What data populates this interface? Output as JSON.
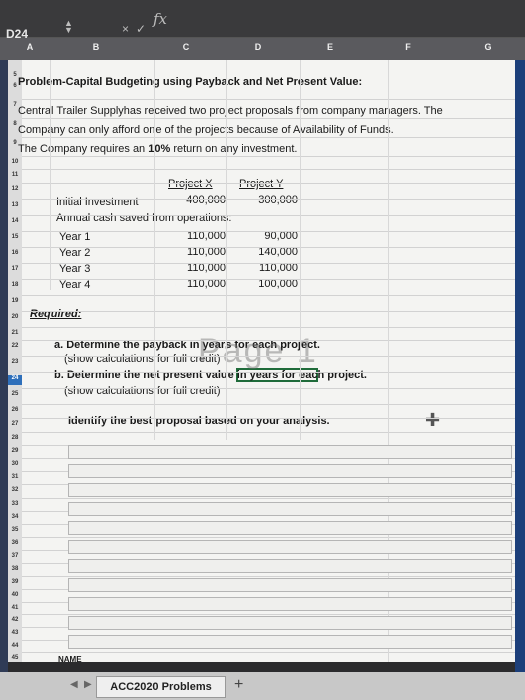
{
  "formula_bar": {
    "name_box": "D24",
    "fx_label": "fx",
    "cancel": "×",
    "confirm": "✓",
    "value": ""
  },
  "columns": [
    "A",
    "B",
    "C",
    "D",
    "E",
    "F",
    "G"
  ],
  "selected_row": "24",
  "rows": [
    "5",
    "6",
    "7",
    "8",
    "9",
    "10",
    "11",
    "12",
    "13",
    "14",
    "15",
    "16",
    "17",
    "18",
    "19",
    "20",
    "21",
    "22",
    "23",
    "24",
    "25",
    "26",
    "27",
    "28",
    "29",
    "30",
    "31",
    "32",
    "33",
    "34",
    "35",
    "36",
    "37",
    "38",
    "39",
    "40",
    "41",
    "42",
    "43",
    "44",
    "45",
    "46"
  ],
  "sheet": {
    "title": "Problem-Capital Budgeting using Payback and Net Present Value:",
    "intro_line1": "Central Trailer Supplyhas received two project proposals from company managers. The",
    "intro_line2": "Company can only afford one of the projects because of Availability of Funds.",
    "intro_line3_pre": "The Company requires an ",
    "intro_line3_bold": "10%",
    "intro_line3_post": " return on any investment.",
    "header_x": "Project X",
    "header_y": "Project Y",
    "initial_label": "Initial Investment",
    "initial_x": "400,000",
    "initial_y": "300,000",
    "annual_label": "Annual cash saved from operations:",
    "years": [
      {
        "label": "Year 1",
        "x": "110,000",
        "y": "90,000"
      },
      {
        "label": "Year 2",
        "x": "110,000",
        "y": "140,000"
      },
      {
        "label": "Year 3",
        "x": "110,000",
        "y": "110,000"
      },
      {
        "label": "Year 4",
        "x": "110,000",
        "y": "100,000"
      }
    ],
    "required_label": "Required:",
    "req_a_line1": "a. Determine the payback in years for each project.",
    "req_a_line2": "(show calculations for full credit)",
    "req_b_line1": "b. Determine the net present value in years for each project.",
    "req_b_line2": "(show calculations for full credit)",
    "identify": "Identify the best proposal based on your analysis.",
    "name_label": "NAME",
    "watermark": "Page 1"
  },
  "tabs": {
    "active": "ACC2020 Problems",
    "add": "+"
  }
}
